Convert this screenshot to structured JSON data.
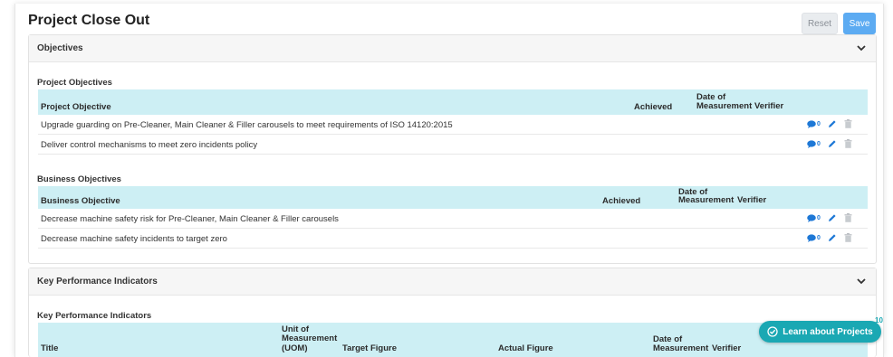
{
  "page": {
    "title": "Project Close Out",
    "reset_label": "Reset",
    "save_label": "Save"
  },
  "objectives_panel": {
    "title": "Objectives",
    "project_section": {
      "label": "Project Objectives",
      "headers": {
        "objective": "Project Objective",
        "achieved": "Achieved",
        "date_line1": "Date of",
        "date_line2": "Measurement",
        "verifier": "Verifier"
      },
      "rows": [
        {
          "text": "Upgrade guarding on Pre-Cleaner, Main Cleaner & Filler carousels to meet requirements of ISO 14120:2015",
          "comments": "0"
        },
        {
          "text": "Deliver control mechanisms to meet zero incidents policy",
          "comments": "0"
        }
      ]
    },
    "business_section": {
      "label": "Business Objectives",
      "headers": {
        "objective": "Business Objective",
        "achieved": "Achieved",
        "date_line1": "Date of",
        "date_line2": "Measurement",
        "verifier": "Verifier"
      },
      "rows": [
        {
          "text": "Decrease machine safety risk for Pre-Cleaner, Main Cleaner & Filler carousels",
          "comments": "0"
        },
        {
          "text": "Decrease machine safety incidents to target zero",
          "comments": "0"
        }
      ]
    }
  },
  "kpi_panel": {
    "title": "Key Performance Indicators",
    "section_label": "Key Performance Indicators",
    "headers": {
      "title": "Title",
      "uom_line1": "Unit of",
      "uom_line2": "Measurement",
      "uom_line3": "(UOM)",
      "target": "Target Figure",
      "actual": "Actual Figure",
      "date_line1": "Date of",
      "date_line2": "Measurement",
      "verifier": "Verifier"
    }
  },
  "learn": {
    "label": "Learn about Projects",
    "badge": "10"
  },
  "colors": {
    "accent_blue": "#5cabf2",
    "header_teal": "#cdeff4",
    "learn_teal": "#1aa8b3",
    "icon_blue": "#1e78d6"
  },
  "icons": [
    "chevron-down-icon",
    "comment-icon",
    "edit-pencil-icon",
    "trash-icon",
    "check-badge-icon"
  ]
}
